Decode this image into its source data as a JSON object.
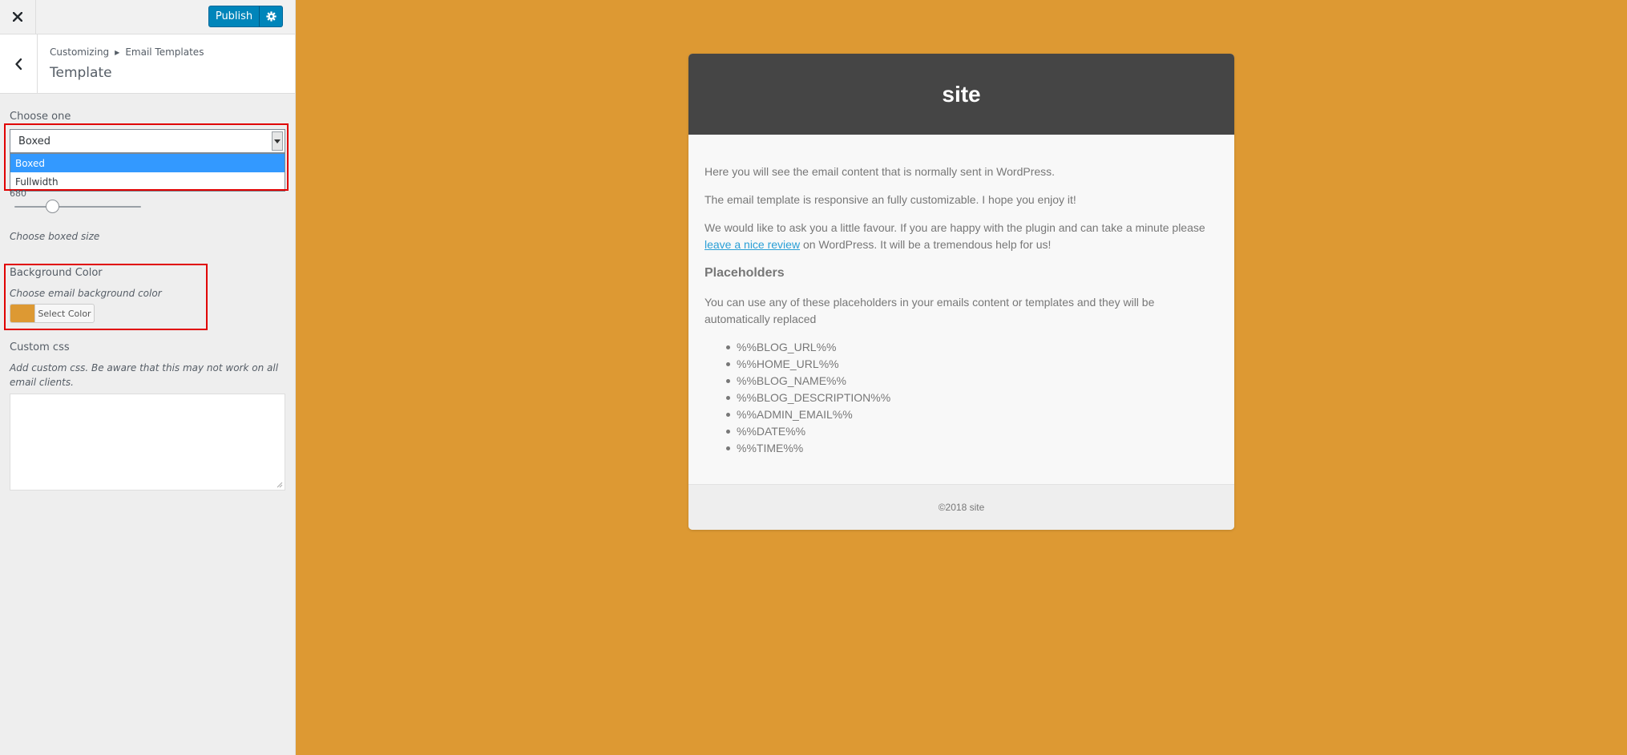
{
  "topbar": {
    "close_icon": "close-icon",
    "publish_label": "Publish",
    "settings_icon": "gear-icon"
  },
  "section": {
    "back_icon": "chevron-left-icon",
    "breadcrumb": [
      "Customizing",
      "Email Templates"
    ],
    "breadcrumb_separator_icon": "triangle-right-icon",
    "title": "Template"
  },
  "template_control": {
    "label": "Choose one",
    "selected": "Boxed",
    "options": [
      "Boxed",
      "Fullwidth"
    ],
    "dropdown_open": true
  },
  "boxed_size": {
    "value": "680",
    "slider_fraction": 0.3,
    "description": "Choose boxed size"
  },
  "background_color": {
    "label": "Background Color",
    "description": "Choose email background color",
    "button_label": "Select Color",
    "value": "#dd9933"
  },
  "custom_css": {
    "label": "Custom css",
    "description": "Add custom css. Be aware that this may not work on all email clients.",
    "value": ""
  },
  "colors": {
    "accent": "#0085ba",
    "preview_background": "#dd9933",
    "header_background": "#454545",
    "highlight": "#e00000",
    "link": "#2a9fd6"
  },
  "preview": {
    "site_name": "site",
    "paragraphs": [
      "Here you will see the email content that is normally sent in WordPress.",
      "The email template is responsive an fully customizable. I hope you enjoy it!"
    ],
    "favour_before": "We would like to ask you a little favour. If you are happy with the plugin and can take a minute please ",
    "favour_link": "leave a nice review",
    "favour_after": " on WordPress. It will be a tremendous help for us!",
    "placeholders_title": "Placeholders",
    "placeholders_intro": "You can use any of these placeholders in your emails content or templates and they will be automatically replaced",
    "placeholders": [
      "%%BLOG_URL%%",
      "%%HOME_URL%%",
      "%%BLOG_NAME%%",
      "%%BLOG_DESCRIPTION%%",
      "%%ADMIN_EMAIL%%",
      "%%DATE%%",
      "%%TIME%%"
    ],
    "footer": "©2018 site"
  }
}
